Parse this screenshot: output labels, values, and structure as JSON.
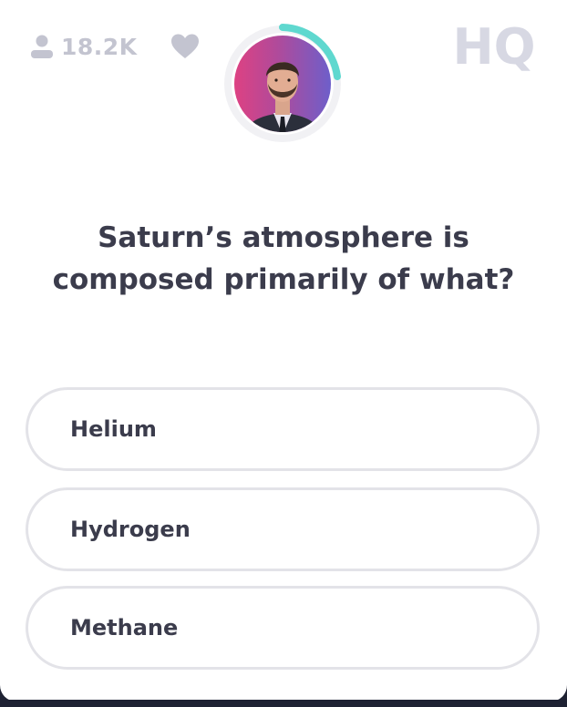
{
  "header": {
    "viewer_count": "18.2K",
    "logo_text": "HQ",
    "icons": {
      "viewers": "person-icon",
      "like": "heart-icon",
      "host": "host-avatar",
      "timer": "timer-ring"
    }
  },
  "question": {
    "text": "Saturn’s atmosphere is composed primarily of what?"
  },
  "answers": [
    {
      "label": "Helium"
    },
    {
      "label": "Hydrogen"
    },
    {
      "label": "Methane"
    }
  ],
  "colors": {
    "timer_ring": "#5fd8cf",
    "text": "#3b3c4c",
    "muted": "#c3c4d0",
    "logo": "#d7d8e3",
    "option_border": "#e3e3e8"
  }
}
